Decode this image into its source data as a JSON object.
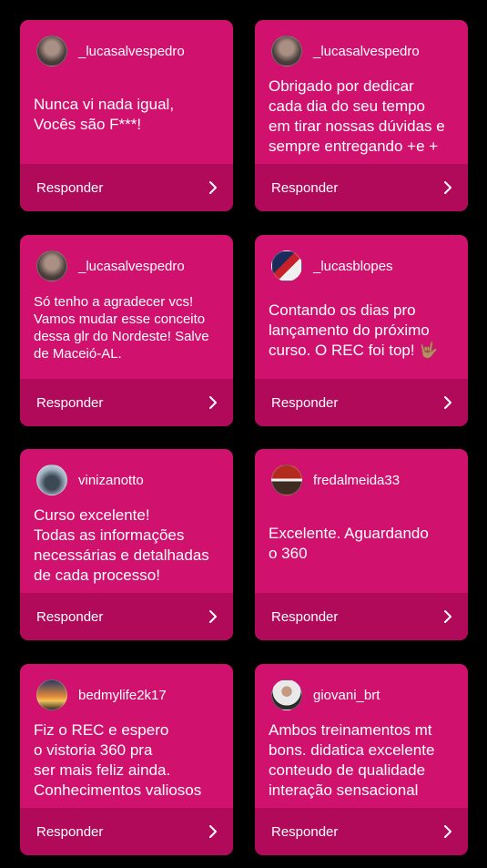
{
  "reply_label": "Responder",
  "icons": {
    "avatar": "avatar-image",
    "chevron": "chevron-right-icon"
  },
  "cards": [
    {
      "username": "_lucasalvespedro",
      "message": "Nunca vi nada igual,\nVocês são F***!",
      "avatar_color": "#6b5a55"
    },
    {
      "username": "_lucasalvespedro",
      "message": "Obrigado por dedicar\ncada dia do seu tempo\nem tirar nossas dúvidas e\nsempre entregando +e +",
      "avatar_color": "#6b5a55"
    },
    {
      "username": "_lucasalvespedro",
      "message": "Só tenho a agradecer vcs!\nVamos mudar esse conceito\ndessa glr do Nordeste! Salve\nde Maceió-AL.",
      "avatar_color": "#6b5a55"
    },
    {
      "username": "_lucasblopes",
      "message": "Contando os dias pro\nlançamento do próximo\ncurso. O REC foi top! 🤟🏽",
      "avatar_color": "#3a3f52"
    },
    {
      "username": "vinizanotto",
      "message": "Curso excelente!\nTodas as informações\nnecessárias e detalhadas\nde cada processo!",
      "avatar_color": "#7b8fa0"
    },
    {
      "username": "fredalmeida33",
      "message": "Excelente. Aguardando\no 360",
      "avatar_color": "#8a3b2f"
    },
    {
      "username": "bedmylife2k17",
      "message": "Fiz o REC e espero\no vistoria 360 pra\nser mais feliz ainda.\nConhecimentos valiosos",
      "avatar_color": "#c9923a"
    },
    {
      "username": "giovani_brt",
      "message": "Ambos treinamentos mt\nbons. didatica excelente\nconteudo de qualidade\ninteração sensacional",
      "avatar_color": "#dcdcdc"
    }
  ]
}
